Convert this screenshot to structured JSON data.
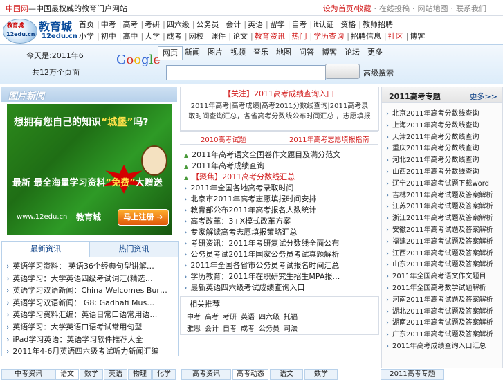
{
  "topbar": {
    "text_hl": "中国网",
    "text_rest": "—中国最权威的教育门户网站",
    "links": [
      {
        "label": "设为首页/收藏",
        "red": true
      },
      {
        "label": "在线投稿",
        "red": false
      },
      {
        "label": "网站地图",
        "red": false
      },
      {
        "label": "联系我们",
        "red": false
      }
    ]
  },
  "logo": {
    "circle_top": "教育城",
    "circle_bottom": "12edu.cn",
    "brand": "教育城",
    "domain": "12edu.cn"
  },
  "nav": {
    "row1": [
      "首页",
      "中考",
      "高考",
      "考研",
      "四六级",
      "公务员",
      "会计",
      "英语",
      "留学",
      "自考",
      "it认证",
      "资格",
      "教师招聘"
    ],
    "row2": [
      "小学",
      "初中",
      "高中",
      "大学",
      "成考",
      "网校",
      "课件",
      "论文",
      "教育资讯",
      "热门",
      "学历查询",
      "招聘信息",
      "社区",
      "博客"
    ],
    "row2_red": [
      8,
      9,
      10,
      12
    ]
  },
  "search": {
    "date": "今天是:2011年6",
    "count": "共12万个页面",
    "google": [
      "G",
      "o",
      "o",
      "g",
      "l",
      "e"
    ],
    "tabs": [
      "网页",
      "新闻",
      "图片",
      "视频",
      "音乐",
      "地图",
      "问答",
      "博客",
      "论坛",
      "更多"
    ],
    "input_value": "",
    "button_label": "",
    "advanced": "高级搜索"
  },
  "left": {
    "header": "图片新闻",
    "banner": {
      "question_a": "想拥有您自己的知识",
      "question_hl": "“城堡”",
      "question_b": "吗?",
      "mid_a": "最新 最全海量学习资料",
      "mid_hl": "“免费”",
      "mid_b": "大赠送",
      "url": "www.12edu.cn",
      "brand": "教育城",
      "register": "马上注册 ➔"
    },
    "tabs": [
      "最新资讯",
      "热门资讯"
    ],
    "items": [
      "英语学习资料： 英语36个经典句型讲解…",
      "英语学习：大学英语四级考试词汇(精选…",
      "英语学习双语新闻：China Welcomes Bur…",
      "英语学习双语新闻： G8: Gadhafi Mus…",
      "英语学习资料汇编：英语日常口语常用语…",
      "英语学习：大学英语口语考试常用句型",
      "iPad学习英语：英语学习软件推荐大全",
      "2011年4-6月英语四六级考试听力新闻汇编"
    ]
  },
  "middle": {
    "title": "【关注】2011高考成绩查询入口",
    "text": "2011年高考|高考成绩|高考2011分数线查询|2011高考录取时间查询汇总，各省高考分数线公布时间汇总 ，志愿填报",
    "links": [
      "2010高考试题",
      "2011年高考志愿填报指南"
    ],
    "items": [
      {
        "text": "2011年高考语文全国卷作文题目及满分范文",
        "tri": true,
        "red": false
      },
      {
        "text": "2011年高考成绩查询",
        "tri": true,
        "red": false
      },
      {
        "text": "【聚焦】2011高考分数线汇总",
        "tri": true,
        "red": true
      },
      {
        "text": "2011年全国各地高考录取时间",
        "tri": false,
        "red": false
      },
      {
        "text": "北京市2011年高考志愿填报时间安排",
        "tri": false,
        "red": false
      },
      {
        "text": "教育部公布2011年高考报名人数统计",
        "tri": false,
        "red": false
      },
      {
        "text": "高考改革：3+X模式改革方案",
        "tri": false,
        "red": false
      },
      {
        "text": "专家解读高考志愿填报策略汇总",
        "tri": false,
        "red": false
      },
      {
        "text": "考研资讯：2011年考研复试分数线全面公布",
        "tri": false,
        "red": false
      },
      {
        "text": "公务员考试2011年国家公务员考试真题解析",
        "tri": false,
        "red": false
      },
      {
        "text": "2011年全国各省市公务员考试报名时间汇总",
        "tri": false,
        "red": false
      },
      {
        "text": "学历教育：2011年在职研究生招生MPA报…",
        "tri": false,
        "red": false
      },
      {
        "text": "最新英语四六级考试成绩查询入口",
        "tri": false,
        "red": false
      }
    ],
    "related_title": "相关推荐",
    "related_rows": [
      [
        "中考",
        "高考",
        "考研",
        "英语",
        "四六级",
        "托福"
      ],
      [
        "雅思",
        "会计",
        "自考",
        "成考",
        "公务员",
        "司法"
      ]
    ]
  },
  "right": {
    "title": "2011高考专题",
    "more": "更多>>",
    "items": [
      "北京2011年高考分数线查询",
      "上海2011年高考分数线查询",
      "天津2011年高考分数线查询",
      "重庆2011年高考分数线查询",
      "河北2011年高考分数线查询",
      "山西2011年高考分数线查询",
      "辽宁2011年高考试题下载word",
      "吉林2011年高考试题及答案解析",
      "江苏2011年高考试题及答案解析",
      "浙江2011年高考试题及答案解析",
      "安徽2011年高考试题及答案解析",
      "福建2011年高考试题及答案解析",
      "江西2011年高考试题及答案解析",
      "山东2011年高考试题及答案解析",
      "2011年全国高考语文作文题目",
      "2011年全国高考数学试题解析",
      "河南2011年高考试题及答案解析",
      "湖北2011年高考试题及答案解析",
      "湖南2011年高考试题及答案解析",
      "广东2011年高考试题及答案解析",
      "2011年高考成绩查询入口汇总"
    ]
  },
  "bottom": {
    "tabs": [
      "中考资讯",
      "语文",
      "数学",
      "英语",
      "物理",
      "化学",
      "高考资讯",
      "高考动态",
      "语文",
      "数学",
      "2011高考专题"
    ]
  }
}
